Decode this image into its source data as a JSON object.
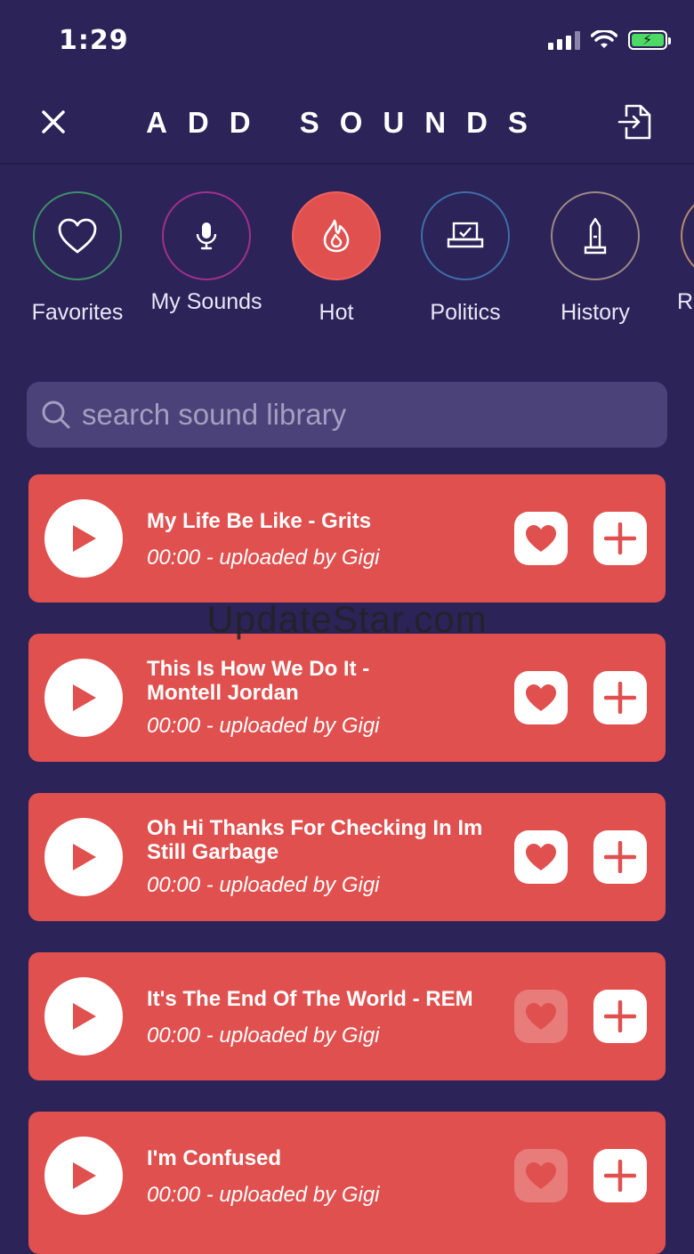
{
  "status_bar": {
    "time": "1:29"
  },
  "header": {
    "title": "ADD SOUNDS"
  },
  "categories": [
    {
      "label": "Favorites",
      "color": "#3f8f6a",
      "icon": "heart-icon"
    },
    {
      "label": "My Sounds",
      "color": "#a0308e",
      "icon": "microphone-icon"
    },
    {
      "label": "Hot",
      "color": "#e0504e",
      "icon": "flame-icon"
    },
    {
      "label": "Politics",
      "color": "#3e6ea8",
      "icon": "ballot-box-icon"
    },
    {
      "label": "History",
      "color": "#9b8a84",
      "icon": "monument-icon"
    },
    {
      "label": "R &",
      "color": "#b88a6a",
      "icon": "partial-category-icon"
    }
  ],
  "search": {
    "placeholder": "search sound library"
  },
  "sounds": [
    {
      "title": "My Life Be Like - Grits",
      "meta": "00:00 - uploaded by Gigi",
      "favorited": true
    },
    {
      "title": "This Is How We Do It - Montell Jordan",
      "meta": "00:00 - uploaded by Gigi",
      "favorited": true
    },
    {
      "title": "Oh Hi Thanks For Checking In Im Still Garbage",
      "meta": "00:00 - uploaded by Gigi",
      "favorited": true
    },
    {
      "title": "It's The End Of The World - REM",
      "meta": "00:00 - uploaded by Gigi",
      "favorited": false
    },
    {
      "title": "I'm Confused",
      "meta": "00:00 - uploaded by Gigi",
      "favorited": false
    }
  ],
  "watermark": "UpdateStar.com",
  "colors": {
    "background": "#2c2358",
    "card": "#e0504e",
    "search_bg": "#4b4279"
  }
}
